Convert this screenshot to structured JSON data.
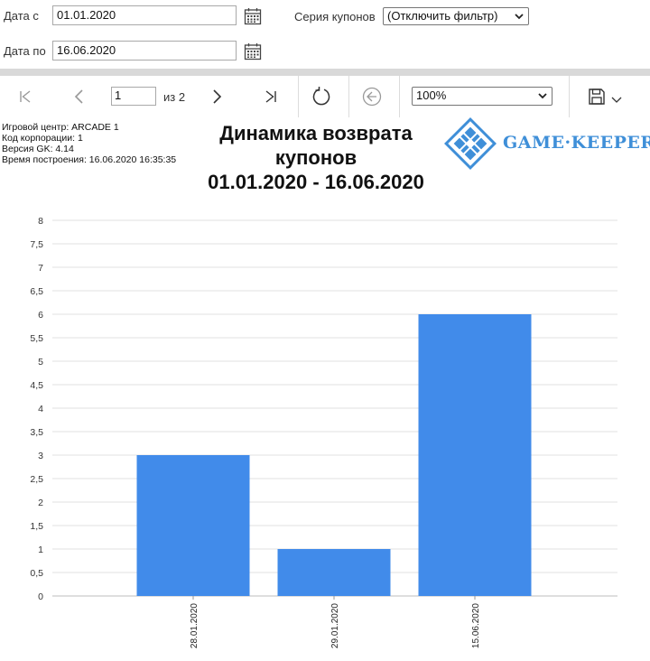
{
  "filters": {
    "date_from_label": "Дата с",
    "date_from_value": "01.01.2020",
    "date_to_label": "Дата по",
    "date_to_value": "16.06.2020",
    "coupon_series_label": "Серия купонов",
    "coupon_series_value": "(Отключить фильтр)"
  },
  "toolbar": {
    "page_value": "1",
    "page_of": "из 2",
    "zoom_value": "100%"
  },
  "report": {
    "meta_lines": [
      "Игровой центр: ARCADE 1",
      "Код корпорации: 1",
      "Версия GK: 4.14",
      "Время построения: 16.06.2020 16:35:35"
    ],
    "title_lines": [
      "Динамика возврата",
      "купонов",
      "01.01.2020 - 16.06.2020"
    ],
    "logo_text": "GAME·KEEPER"
  },
  "colors": {
    "bar": "#418bea",
    "logo": "#3f8fd8"
  },
  "chart_data": {
    "type": "bar",
    "categories": [
      "28.01.2020",
      "29.01.2020",
      "15.06.2020"
    ],
    "values": [
      3,
      1,
      6
    ],
    "ylim": [
      0,
      8
    ],
    "yticks": [
      "0",
      "0,5",
      "1",
      "1,5",
      "2",
      "2,5",
      "3",
      "3,5",
      "4",
      "4,5",
      "5",
      "5,5",
      "6",
      "6,5",
      "7",
      "7,5",
      "8"
    ],
    "grid": true
  }
}
